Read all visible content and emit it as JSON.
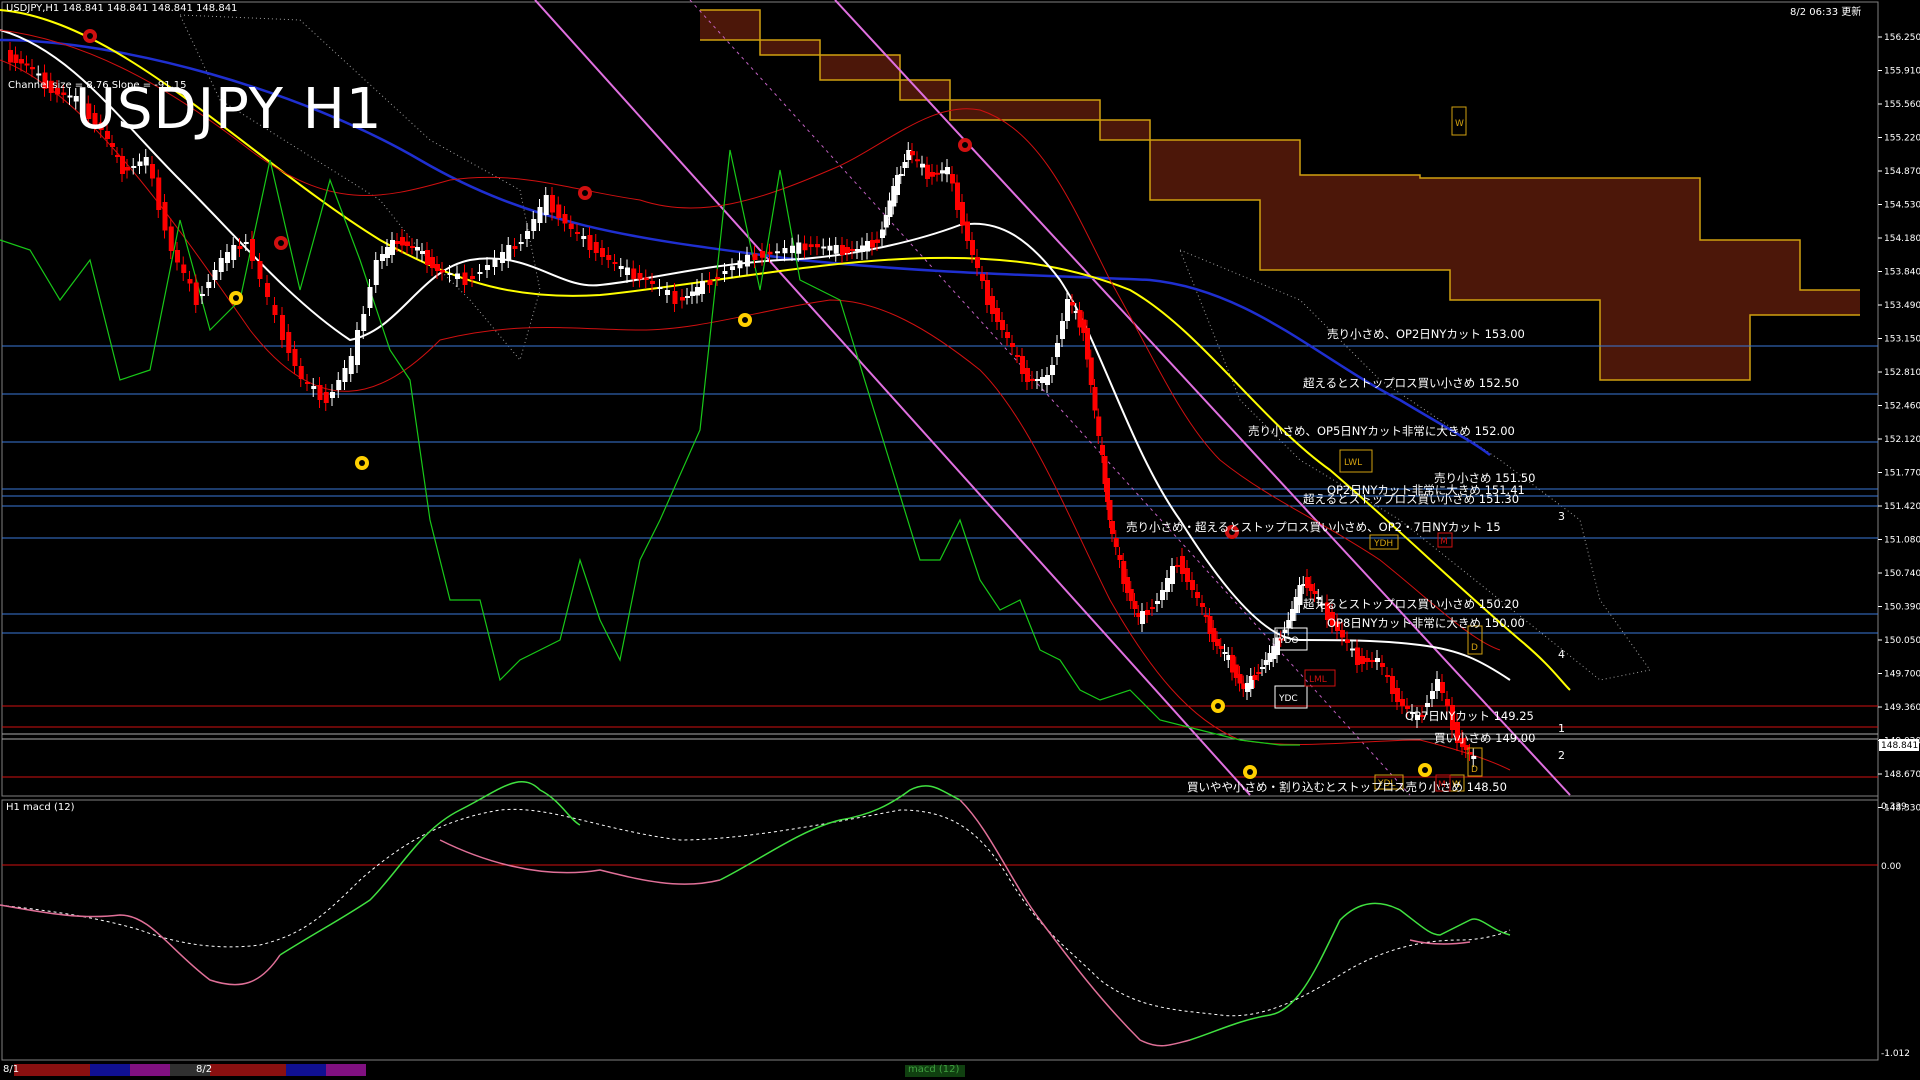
{
  "header": {
    "symbol_info": "USDJPY,H1  148.841 148.841 148.841 148.841",
    "channel_info": "Channel size = 8.76 Slope = -91.15",
    "timestamp": "8/2 06:33 更新",
    "big_title": "USDJPY H1",
    "macd_label": "H1  macd (12)",
    "current_price": "148.841"
  },
  "colors": {
    "background": "#000000",
    "bull_candle": "#ffffff",
    "bear_candle": "#ff0000",
    "ma_white": "#ffffff",
    "ma_yellow": "#ffff00",
    "ma_blue": "#1f2fd0",
    "bollinger": "#d01010",
    "chikou": "#18c818",
    "cloud": "#c84010",
    "cloud_edge": "#d09010",
    "level_line": "#3a78d8",
    "red_level": "#d01010",
    "channel": "#e070e0",
    "macd_up": "#40e040",
    "macd_down": "#e07098"
  },
  "price_axis": {
    "ticks": [
      "156.250",
      "155.910",
      "155.560",
      "155.220",
      "154.870",
      "154.530",
      "154.180",
      "153.840",
      "153.490",
      "153.150",
      "152.810",
      "152.460",
      "152.120",
      "151.770",
      "151.420",
      "151.080",
      "150.740",
      "150.390",
      "150.050",
      "149.700",
      "149.360",
      "149.020",
      "148.670",
      "148.330"
    ]
  },
  "macd_axis": {
    "ticks": [
      "0.339",
      "0.00",
      "-1.012"
    ]
  },
  "level_labels": [
    {
      "text": "売り小さめ、OP2日NYカット 153.00"
    },
    {
      "text": "超えるとストップロス買い小さめ 152.50"
    },
    {
      "text": "売り小さめ、OP5日NYカット非常に大きめ 152.00"
    },
    {
      "text": "売り小さめ 151.50"
    },
    {
      "text": "OP2日NYカット非常に大きめ 151.41"
    },
    {
      "text": "超えるとストップロス買い小さめ 151.30"
    },
    {
      "text": "売り小さめ・超えるとストップロス買い小さめ、OP2・7日NYカット 15"
    },
    {
      "text": "超えるとストップロス買い小さめ 150.20"
    },
    {
      "text": "OP8日NYカット非常に大きめ 150.00"
    },
    {
      "text": "OP7日NYカット 149.25"
    },
    {
      "text": "買い小さめ 149.00"
    },
    {
      "text": "買いやや小さめ・割り込むとストップロス売り小さめ 148.50"
    }
  ],
  "boxes": [
    {
      "text": "W"
    },
    {
      "text": "LWL"
    },
    {
      "text": "YDH"
    },
    {
      "text": "YDO"
    },
    {
      "text": "YDC"
    },
    {
      "text": "LML"
    },
    {
      "text": "YDL"
    },
    {
      "text": "D"
    },
    {
      "text": "D"
    },
    {
      "text": "M"
    },
    {
      "text": "W"
    },
    {
      "text": "M"
    }
  ],
  "wave_numbers": [
    {
      "text": "3"
    },
    {
      "text": "4"
    },
    {
      "text": "1"
    },
    {
      "text": "2"
    }
  ],
  "bottom_tabs": [
    {
      "text": "8/1"
    },
    {
      "text": "8/2"
    },
    {
      "text": "macd (12)"
    }
  ]
}
